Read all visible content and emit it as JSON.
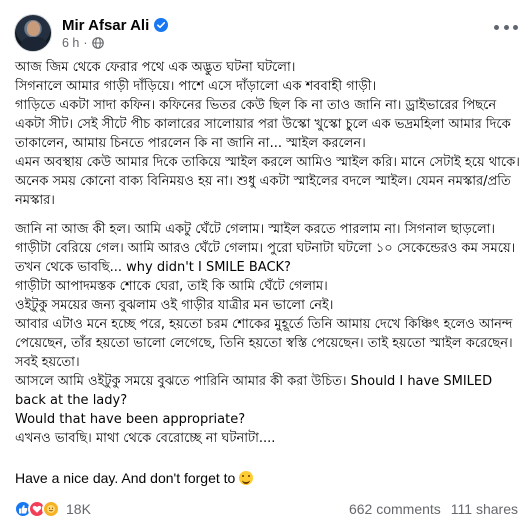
{
  "post": {
    "author_name": "Mir Afsar Ali",
    "time": "6 h",
    "separator": "·",
    "paragraphs": [
      "আজ জিম থেকে ফেরার পথে এক অদ্ভুত ঘটনা ঘটলো।",
      "সিগনালে আমার গাড়ী দাঁড়িয়ে। পাশে এসে দাঁড়ালো এক শববাহী গাড়ী।",
      "গাড়িতে একটা সাদা কফিন। কফিনের ভিতর কেউ ছিল কি না তাও জানি না। ড্রাইভারের পিছনে একটা সীট। সেই সীটে পীচ কালারের সালোয়ার পরা উস্কো খুস্কো চুলে এক ভদ্রমহিলা আমার দিকে তাকালেন, আমায় চিনতে পারলেন কি না জানি না... স্মাইল করলেন।",
      "এমন অবস্থায় কেউ আমার দিকে তাকিয়ে স্মাইল করলে আমিও স্মাইল করি। মানে সেটাই হয়ে থাকে। অনেক সময় কোনো বাক্য বিনিময়ও হয় না। শুধু একটা স্মাইলের বদলে স্মাইল। যেমন নমস্কার/প্রতি নমস্কার।",
      "জানি না আজ কী হল। আমি একটু ঘেঁটে গেলাম। স্মাইল করতে পারলাম না। সিগনাল ছাড়লো। গাড়ীটা বেরিয়ে গেল। আমি আরও ঘেঁটে গেলাম। পুরো ঘটনাটা ঘটলো ১০ সেকেন্ডেরও কম সময়ে।",
      "তখন থেকে ভাবছি... why didn't I SMILE BACK?",
      "গাড়ীটা আপাদমস্তক শোকে ঘেরা, তাই কি আমি ঘেঁটে গেলাম।",
      "ওইটুকু সময়ের জন্য বুঝলাম ওই গাড়ীর যাত্রীর মন ভালো নেই।",
      "আবার এটাও মনে হচ্ছে পরে, হয়তো চরম শোকের মুহূর্তে তিনি আমায় দেখে কিঞ্চিৎ হলেও আনন্দ পেয়েছেন, তাঁর হয়তো ভালো লেগেছে, তিনি হয়তো স্বস্তি পেয়েছেন। তাই হয়তো স্মাইল করেছেন। সবই হয়তো।",
      "আসলে আমি ওইটুকু সময়ে বুঝতে পারিনি আমার কী করা উচিত। Should I have SMILED back at the lady?",
      "Would that have been appropriate?",
      "এখনও ভাবছি। মাথা থেকে বেরোচ্ছে না ঘটনাটা...."
    ],
    "closing": "Have a nice day. And don't forget to"
  },
  "stats": {
    "reaction_count": "18K",
    "comments": "662 comments",
    "shares": "111 shares"
  },
  "icons": {
    "verified": "verified-badge-icon",
    "audience": "globe-icon",
    "more": "more-options-icon",
    "reactions": [
      "like-icon",
      "love-icon",
      "care-icon"
    ],
    "closing_emoji": "smile-emoji-icon"
  },
  "colors": {
    "accent": "#1877f2",
    "love": "#f33e58",
    "care": "#f7b125",
    "secondary_text": "#65676b"
  }
}
